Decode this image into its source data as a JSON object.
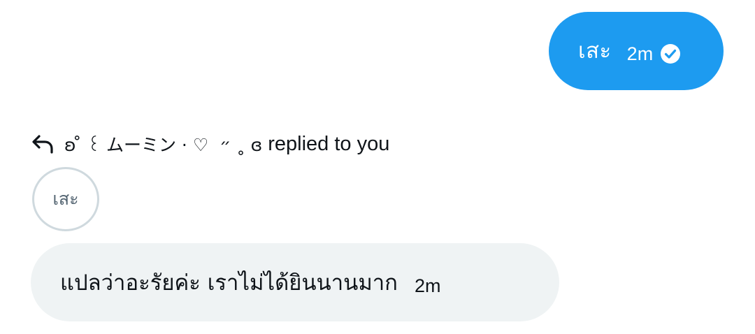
{
  "messages": {
    "outgoing": {
      "text": "เสะ",
      "time": "2m",
      "status_icon": "check-circle-icon"
    },
    "reply": {
      "icon": "reply-arrow-icon",
      "author": "ʚ ̊ ꒰ ムーミン · ♡  ״ ˳ ɞ",
      "label": "replied to you",
      "quoted_text": "เสะ"
    },
    "incoming": {
      "text": "แปลว่าอะรัยค่ะ เราไม่ได้ยินนานมาก",
      "time": "2m"
    }
  },
  "colors": {
    "outgoing_bubble": "#1d9bf0",
    "incoming_bubble": "#eff3f4",
    "quote_border": "#cfd9de",
    "text": "#0f1419"
  }
}
